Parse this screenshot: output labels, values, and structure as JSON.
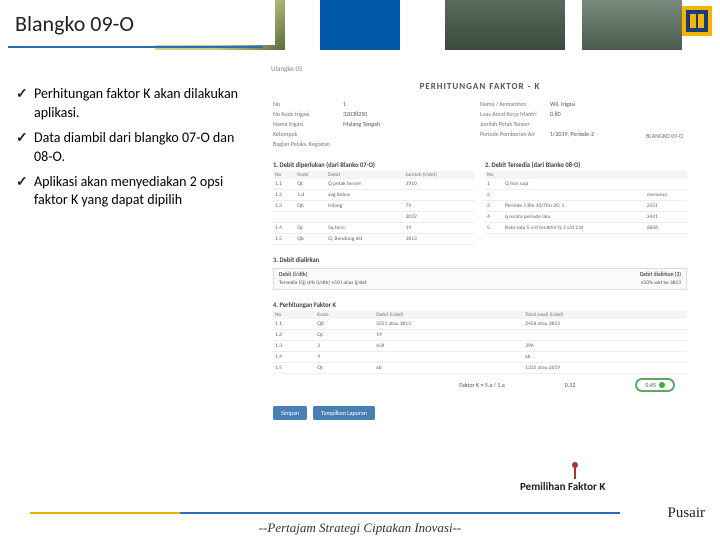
{
  "title": "Blangko 09-O",
  "bullets": [
    "Perhitungan faktor K akan dilakukan aplikasi.",
    "Data diambil dari blangko 07-O dan 08-O.",
    "Aplikasi akan menyediakan 2 opsi faktor K yang dapat dipilih"
  ],
  "screenshot": {
    "breadcrumb": "Ulangke 05",
    "right_badge": "BLANGKO 09-O",
    "heading": "PERHITUNGAN FAKTOR - K",
    "meta_left": [
      {
        "label": "No",
        "val": "1"
      },
      {
        "label": "No Kode Irigasi",
        "val": "32038250"
      },
      {
        "label": "Nama Irigasi",
        "val": "Malang Tengah"
      },
      {
        "label": "Kelompok",
        "val": ""
      }
    ],
    "meta_right": [
      {
        "label": "Nama / Kemantren",
        "val": "Wil. Irigasi"
      },
      {
        "label": "Luas Areal Kerja Mantri",
        "val": "0.80"
      },
      {
        "label": "Jumlah Petak Tersier",
        "val": ""
      },
      {
        "label": "Periode Pemberian Air",
        "val": "1/2019, Periode-2"
      }
    ],
    "ranting": "Bagian Pelaks. Kegiatan",
    "col1_title": "1. Debit diperlukan (dari Blanko 07-O)",
    "col2_title": "2. Debit Tersedia (dari Blanko 08-O)",
    "tbl1_head": [
      "No",
      "Kode",
      "Debit",
      "Jumlah (l/det)"
    ],
    "tbl1": [
      [
        "1.1",
        "Qt",
        "Q petak tersier",
        "3910"
      ],
      [
        "1.2",
        "1.d",
        "xxg bebas",
        ""
      ],
      [
        "1.3",
        "Qb",
        "Hilang",
        "79"
      ],
      [
        "",
        "",
        "",
        "3022"
      ],
      [
        "1.4",
        "Qc",
        "Sq.tersi.",
        "14"
      ],
      [
        "1.5",
        "Qb",
        "Q. Bendung dst",
        "3813"
      ]
    ],
    "tbl2_head": [
      "No",
      "",
      ""
    ],
    "tbl2": [
      [
        "1",
        "Q min saja",
        ""
      ],
      [
        "2",
        "",
        "menurun"
      ],
      [
        "3",
        "Periode 1 Bln 10/Thn 20: 1",
        "2551"
      ],
      [
        "4",
        "q rerata periode lalu",
        "3421"
      ],
      [
        "5",
        "Rata-rata 5 s/d terakhir Q 3 s/d 2 bl",
        "6836"
      ]
    ],
    "sec3_title": "3. Debit dialirkan",
    "sec3_box_head": "Debit dialirkan (3)",
    "sec3_left": {
      "label": "Debit (l/dtk)",
      "sub": "Tersedia (Q) d/b (l/dtk)  ≥50 l  alias  lj/det"
    },
    "sec3_right": {
      "label": "",
      "val": "≥50% wkt ke 3813"
    },
    "sec4_title": "4. Perhitungan Faktor K",
    "tbl4_head": [
      "No",
      "Kode",
      "Debit (l/det)",
      "Total sasdi (l/det)"
    ],
    "tbl4": [
      [
        "1.1",
        "Qb",
        "2551 atau 3813",
        "2458 atau 3813"
      ],
      [
        "1.2",
        "Qc",
        "14",
        ""
      ],
      [
        "1.3",
        "3",
        "634",
        "396"
      ],
      [
        "1.4",
        "4",
        "",
        "xb"
      ],
      [
        "1.5",
        "Qt",
        "xb",
        "1215 atau 2619"
      ]
    ],
    "faktor_label": "Faktor K = 5.a / 1.a",
    "faktor_val1": "0.32",
    "faktor_val2": "0.45",
    "btn1": "Simpan",
    "btn2": "Tampilkan Laporan"
  },
  "callout": "Pemilihan Faktor K",
  "footer": "--Pertajam Strategi Ciptakan Inovasi--",
  "corner": "Pusair"
}
